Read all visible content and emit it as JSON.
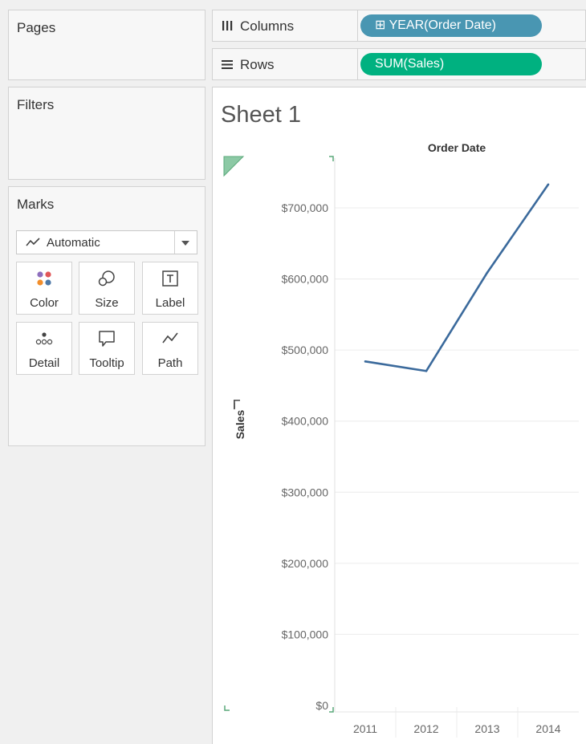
{
  "cards": {
    "pages": {
      "title": "Pages"
    },
    "filters": {
      "title": "Filters"
    },
    "marks": {
      "title": "Marks",
      "mark_type": "Automatic",
      "buttons": [
        {
          "label": "Color",
          "icon": "color-icon"
        },
        {
          "label": "Size",
          "icon": "size-icon"
        },
        {
          "label": "Label",
          "icon": "label-icon"
        },
        {
          "label": "Detail",
          "icon": "detail-icon"
        },
        {
          "label": "Tooltip",
          "icon": "tooltip-icon"
        },
        {
          "label": "Path",
          "icon": "path-icon"
        }
      ]
    }
  },
  "shelves": {
    "columns": {
      "label": "Columns",
      "pill": "⊞ YEAR(Order Date)",
      "pill_color": "#4996b2"
    },
    "rows": {
      "label": "Rows",
      "pill": "SUM(Sales)",
      "pill_color": "#00b180"
    }
  },
  "sheet": {
    "title": "Sheet 1"
  },
  "chart_data": {
    "type": "line",
    "title": "Order Date",
    "xlabel": "Order Date",
    "ylabel": "Sales",
    "categories": [
      "2011",
      "2012",
      "2013",
      "2014"
    ],
    "series": [
      {
        "values": [
          484000,
          470500,
          609000,
          733000
        ],
        "color": "#3b6a9c"
      }
    ],
    "ylim": [
      0,
      700000
    ],
    "yticks": [
      {
        "value": 700000,
        "label": "$700,000"
      },
      {
        "value": 600000,
        "label": "$600,000"
      },
      {
        "value": 500000,
        "label": "$500,000"
      },
      {
        "value": 400000,
        "label": "$400,000"
      },
      {
        "value": 300000,
        "label": "$300,000"
      },
      {
        "value": 200000,
        "label": "$200,000"
      },
      {
        "value": 100000,
        "label": "$100,000"
      },
      {
        "value": 0,
        "label": "$0"
      }
    ],
    "grid": true
  }
}
